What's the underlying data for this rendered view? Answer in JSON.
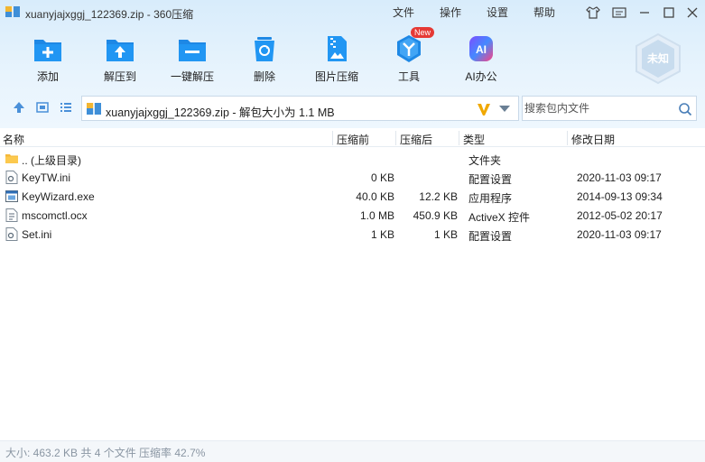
{
  "window": {
    "title": "xuanyjajxggj_122369.zip - 360压缩",
    "menu": [
      "文件",
      "操作",
      "设置",
      "帮助"
    ]
  },
  "toolbar": {
    "items": [
      {
        "label": "添加",
        "icon": "add-icon"
      },
      {
        "label": "解压到",
        "icon": "extract-to-icon"
      },
      {
        "label": "一键解压",
        "icon": "one-click-extract-icon"
      },
      {
        "label": "删除",
        "icon": "delete-icon"
      },
      {
        "label": "图片压缩",
        "icon": "image-compress-icon"
      },
      {
        "label": "工具",
        "icon": "tools-icon"
      },
      {
        "label": "AI办公",
        "icon": "ai-office-icon"
      }
    ],
    "new_badge": "New",
    "ai_glyph": "AI",
    "user_badge": "未知"
  },
  "nav": {
    "path": "xuanyjajxggj_122369.zip - 解包大小为 1.1 MB",
    "search_placeholder": "搜索包内文件"
  },
  "columns": {
    "name": "名称",
    "before": "压缩前",
    "after": "压缩后",
    "type": "类型",
    "modified": "修改日期"
  },
  "files": [
    {
      "name": ".. (上级目录)",
      "before": "",
      "after": "",
      "type": "文件夹",
      "modified": "",
      "icon": "folder-icon"
    },
    {
      "name": "KeyTW.ini",
      "before": "0 KB",
      "after": "",
      "type": "配置设置",
      "modified": "2020-11-03 09:17",
      "icon": "ini-file-icon"
    },
    {
      "name": "KeyWizard.exe",
      "before": "40.0 KB",
      "after": "12.2 KB",
      "type": "应用程序",
      "modified": "2014-09-13 09:34",
      "icon": "exe-file-icon"
    },
    {
      "name": "mscomctl.ocx",
      "before": "1.0 MB",
      "after": "450.9 KB",
      "type": "ActiveX 控件",
      "modified": "2012-05-02 20:17",
      "icon": "ocx-file-icon"
    },
    {
      "name": "Set.ini",
      "before": "1 KB",
      "after": "1 KB",
      "type": "配置设置",
      "modified": "2020-11-03 09:17",
      "icon": "ini-file-icon"
    }
  ],
  "status": "大小: 463.2 KB 共 4 个文件 压缩率 42.7%"
}
